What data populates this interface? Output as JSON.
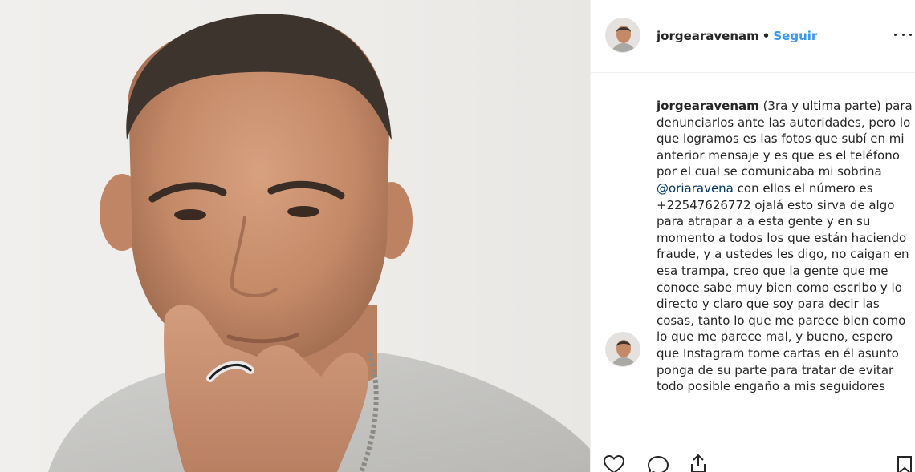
{
  "post": {
    "username": "jorgearavenam",
    "separator": "•",
    "follow_label": "Seguir",
    "more_icon": "ellipsis-icon"
  },
  "caption": {
    "username": "jorgearavenam",
    "text_1": "(3ra y ultima parte) para denunciarlos ante las autoridades, pero lo que logramos es las fotos que subí en mi anterior mensaje y es que es el teléfono por el cual se comunicaba mi sobrina",
    "mention": "@oriaravena",
    "text_2": "con ellos el número es +22547626772 ojalá esto sirva de algo para atrapar a a esta gente y en su momento a todos los que están haciendo fraude, y a ustedes les digo, no caigan en esa trampa, creo que la gente que me conoce sabe muy bien como escribo y lo directo y claro que soy para decir las cosas, tanto lo que me parece bien como lo que me parece mal, y bueno, espero que Instagram tome cartas en él asunto ponga de su parte para tratar de evitar todo posible engaño a mis seguidores"
  },
  "actions": {
    "like_icon": "heart-icon",
    "comment_icon": "comment-icon",
    "share_icon": "share-icon",
    "save_icon": "bookmark-icon"
  },
  "colors": {
    "link_blue": "#3897f0",
    "mention_blue": "#003569",
    "text": "#262626",
    "border": "#efefef"
  }
}
